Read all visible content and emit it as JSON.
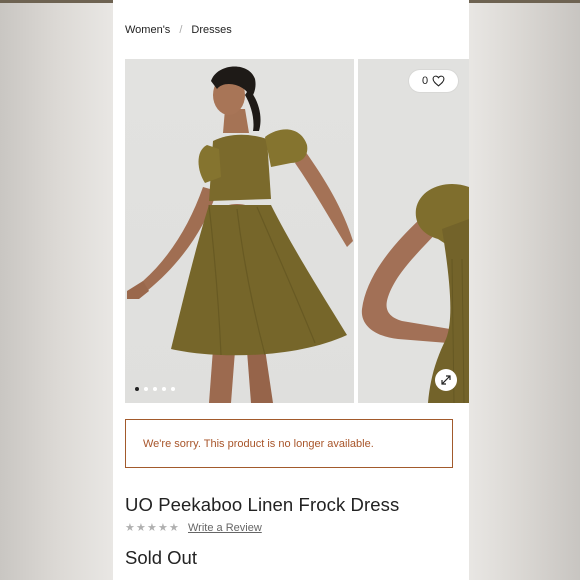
{
  "breadcrumb": {
    "items": [
      "Women's",
      "Dresses"
    ],
    "separator": "/"
  },
  "gallery": {
    "slide_count": 5,
    "active_slide": 1,
    "like_count": "0"
  },
  "notice": {
    "message": "We're sorry. This product is no longer available.",
    "border_color": "#a25a2c"
  },
  "product": {
    "title": "UO Peekaboo Linen Frock Dress",
    "rating_stars": 5,
    "rating_value": 0,
    "write_review_label": "Write a Review",
    "availability": "Sold Out"
  },
  "icons": {
    "like": "heart-icon",
    "expand": "expand-arrows-icon",
    "rating": "star-icon"
  },
  "colors": {
    "dress": "#7a6a2a",
    "accent": "#a8552a"
  }
}
